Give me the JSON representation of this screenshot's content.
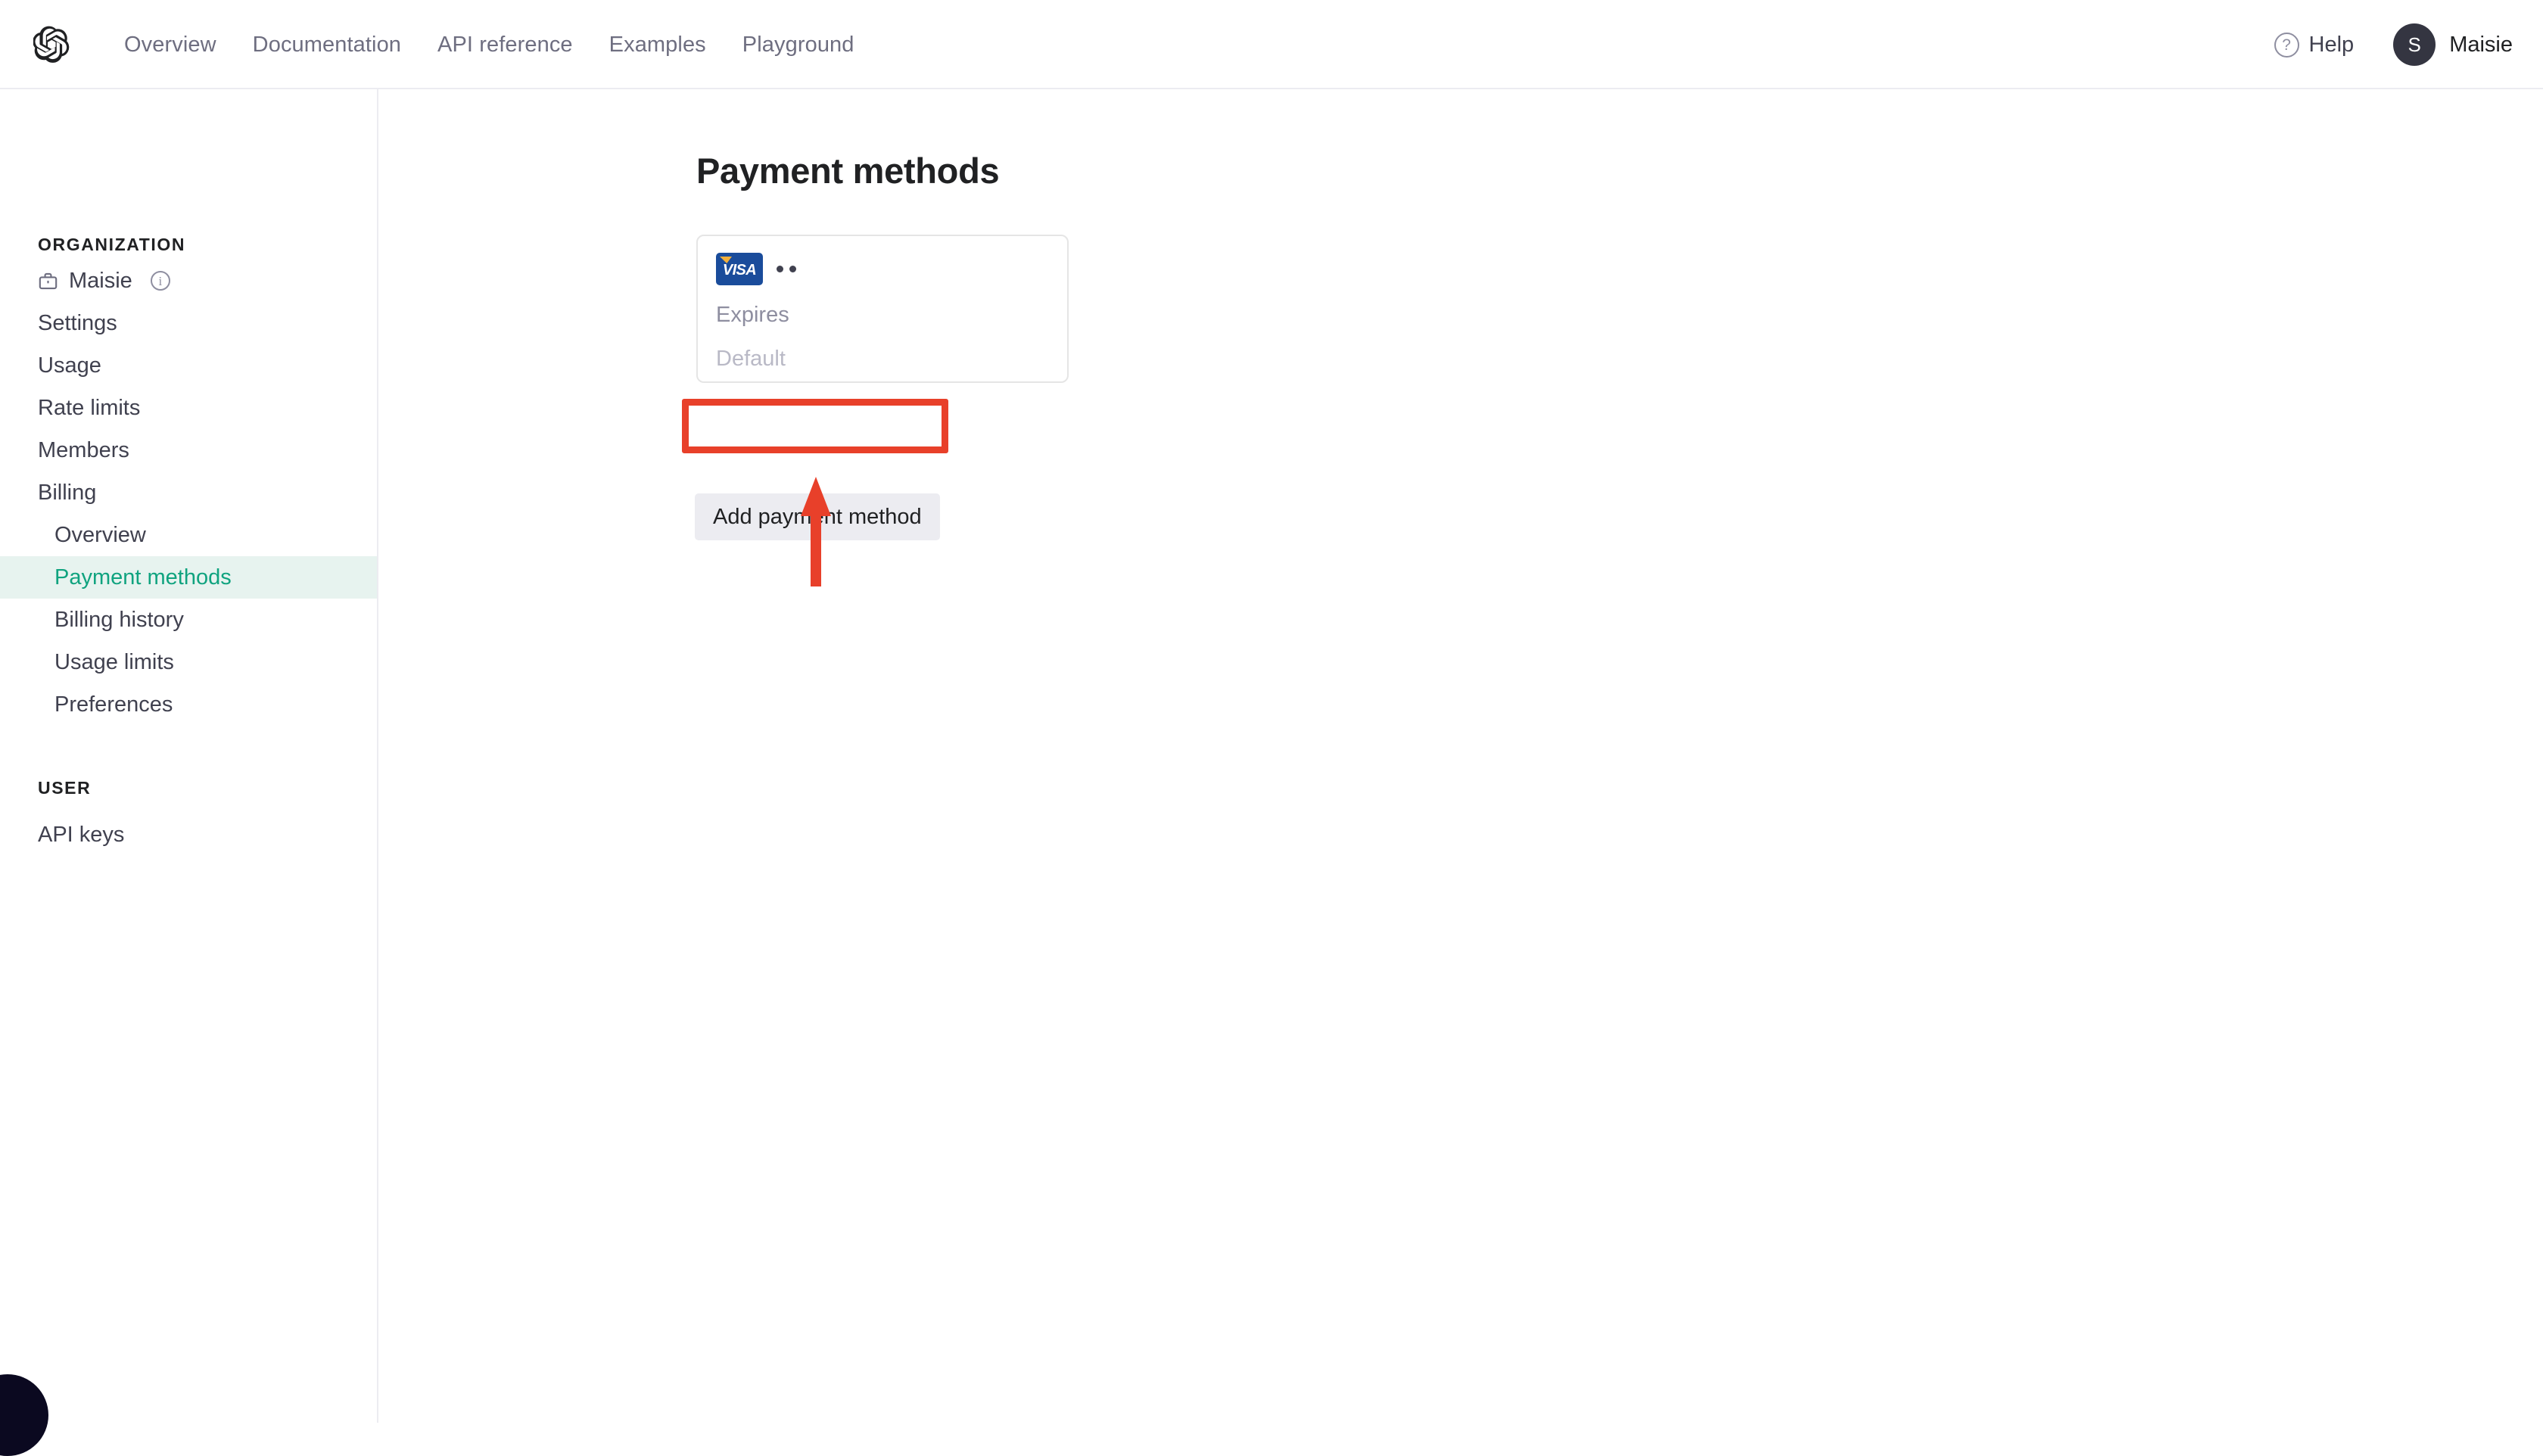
{
  "header": {
    "logo_icon": "openai-logo-icon",
    "nav": [
      {
        "label": "Overview"
      },
      {
        "label": "Documentation"
      },
      {
        "label": "API reference"
      },
      {
        "label": "Examples"
      },
      {
        "label": "Playground"
      }
    ],
    "help": {
      "icon": "question-mark-circle-icon",
      "label": "Help"
    },
    "account": {
      "avatar_initial": "S",
      "name": "Maisie"
    }
  },
  "sidebar": {
    "organization_label": "ORGANIZATION",
    "org": {
      "icon": "briefcase-icon",
      "name": "Maisie",
      "info_icon": "info-circle-icon"
    },
    "org_items": [
      {
        "label": "Settings",
        "active": false
      },
      {
        "label": "Usage",
        "active": false
      },
      {
        "label": "Rate limits",
        "active": false
      },
      {
        "label": "Members",
        "active": false
      },
      {
        "label": "Billing",
        "active": false
      }
    ],
    "billing_items": [
      {
        "label": "Overview",
        "active": false
      },
      {
        "label": "Payment methods",
        "active": true
      },
      {
        "label": "Billing history",
        "active": false
      },
      {
        "label": "Usage limits",
        "active": false
      },
      {
        "label": "Preferences",
        "active": false
      }
    ],
    "user_label": "USER",
    "user_items": [
      {
        "label": "API keys",
        "active": false
      }
    ],
    "active_bg_color": "#e7f3ef",
    "active_text_color": "#10a37f"
  },
  "main": {
    "page_title": "Payment methods",
    "payment_card": {
      "brand_icon": "visa-card-icon",
      "brand_text": "VISA",
      "masked_digits": "••",
      "expires_label": "Expires",
      "default_label": "Default"
    },
    "add_payment_button": "Add payment method"
  },
  "annotation": {
    "highlight_color": "#e8402a",
    "target": "add-payment-method-button",
    "arrow_direction": "up"
  }
}
